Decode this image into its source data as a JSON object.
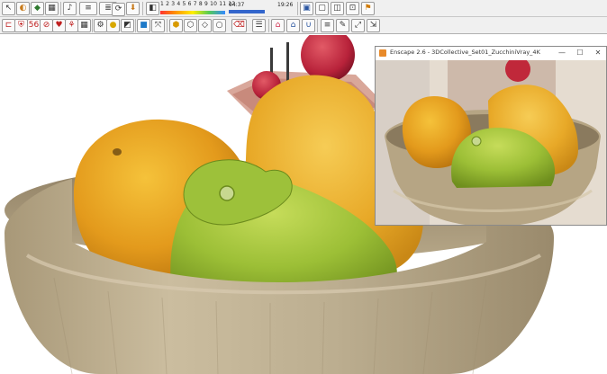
{
  "toolbar_top": {
    "slider_numbers": "1 2 3 4 5 6 7 8 9 10 11 12",
    "time_start": "04:37",
    "time_end": "19:26"
  },
  "preview_window": {
    "title": "Enscape 2.6 - 3DCollective_Set01_ZucchiniVray_4K",
    "minimize_symbol": "—",
    "maximize_symbol": "☐",
    "close_symbol": "✕"
  },
  "icons": {
    "top_row": [
      "select-icon",
      "paint-bucket-icon",
      "component-icon",
      "grid-icon",
      "sound-icon",
      "style-icon",
      "visual-settings-icon",
      "sync-icon",
      "video-icon",
      "export-icon"
    ],
    "second_row": [
      "section-plane-icon",
      "shield-icon",
      "orbit-icon",
      "zoom-icon",
      "heart-icon",
      "pan-icon",
      "grid-icon",
      "gear-icon",
      "layers-icon",
      "lightbulb-icon",
      "shadow-icon",
      "box-icon",
      "rotate-icon",
      "hexagon-icon",
      "outline-icon",
      "diamond-icon",
      "delete-icon",
      "list-icon",
      "home-icon",
      "warehouse-icon",
      "magnet-icon",
      "export-icon",
      "pen-icon",
      "play-icon",
      "expand-icon"
    ]
  },
  "colors": {
    "toolbar_bg": "#f0f0f0",
    "bowl": "#b9a98c",
    "lemon": "#e6a01f",
    "citron": "#9cc43a",
    "apple": "#c0283a"
  }
}
